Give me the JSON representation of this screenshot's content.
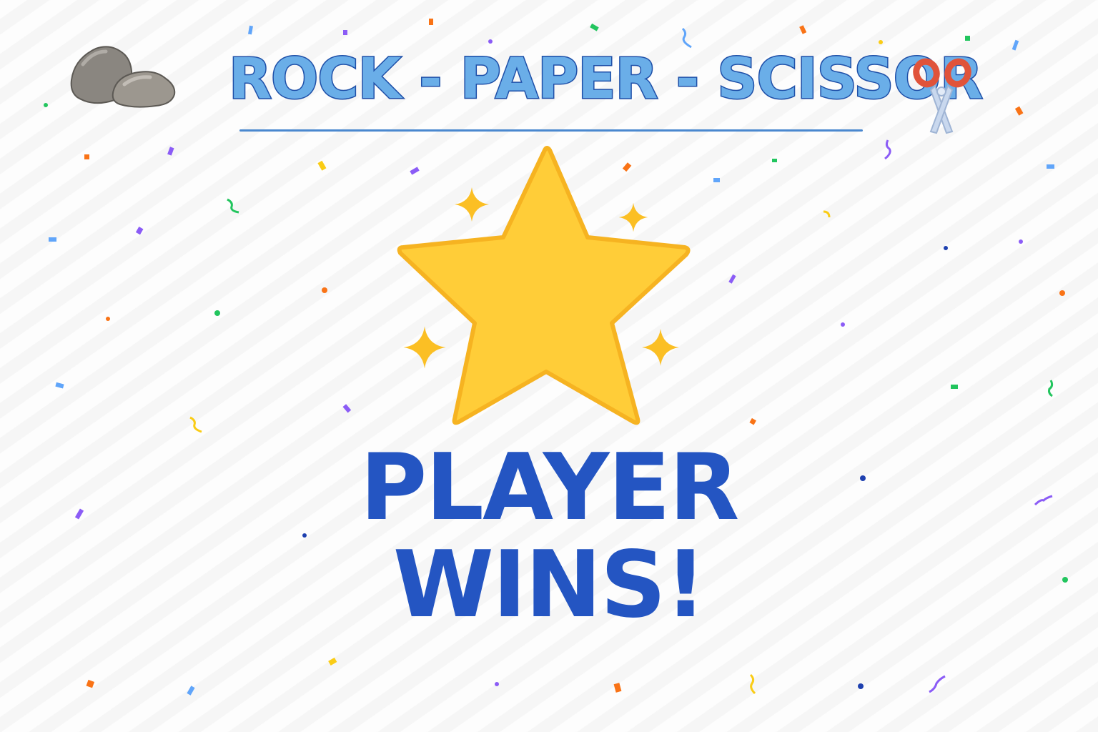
{
  "game": {
    "title": "ROCK - PAPER - SCISSOR",
    "result_line1": "PLAYER",
    "result_line2": "WINS!"
  },
  "icons": {
    "left": "rock-icon",
    "right": "scissors-icon",
    "center": "star-icon",
    "sparkles": "sparkle-icon"
  },
  "colors": {
    "title_fill": "#6aaee8",
    "title_stroke": "#1e4fa8",
    "result_text": "#2455c2",
    "star_fill": "#ffcd38",
    "star_stroke": "#f6b321",
    "confetti": [
      "#3b82f6",
      "#8b5cf6",
      "#22c55e",
      "#f97316",
      "#facc15",
      "#60a5fa",
      "#1e40af"
    ]
  }
}
